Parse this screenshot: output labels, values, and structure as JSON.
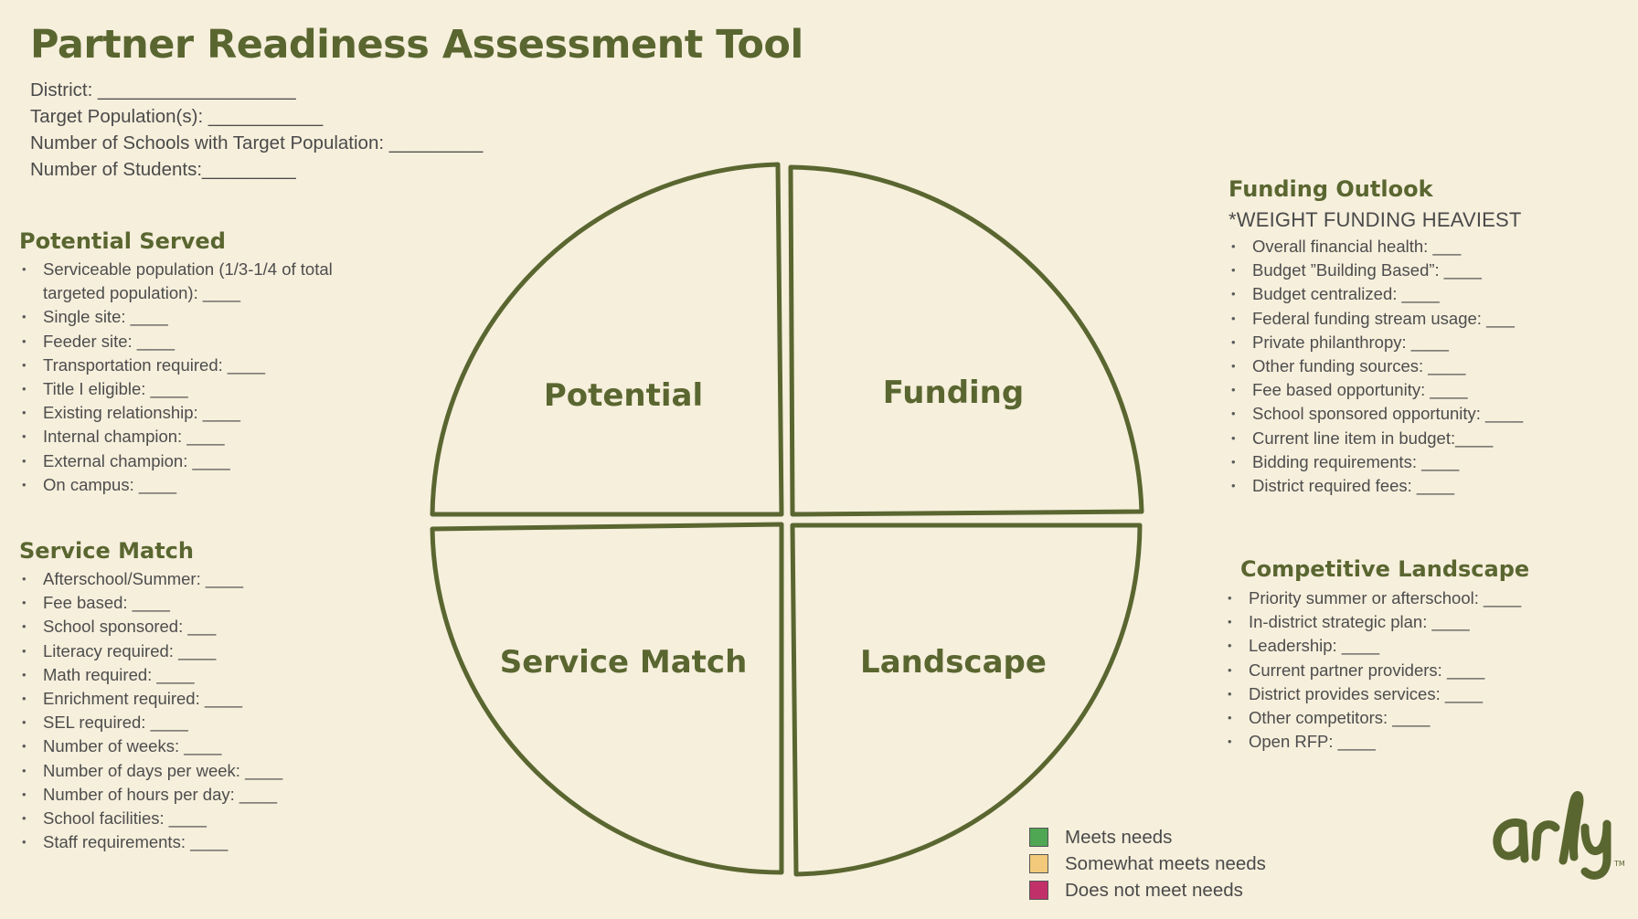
{
  "title": "Partner Readiness Assessment Tool",
  "header_fields": [
    "District:  ___________________",
    "Target Population(s): ___________",
    "Number of Schools with Target Population: _________",
    "Number of Students:_________"
  ],
  "potential_served": {
    "heading": "Potential Served",
    "items": [
      "Serviceable population (1/3-1/4 of total targeted population): ____",
      "Single site: ____",
      "Feeder site: ____",
      "Transportation required: ____",
      "Title I eligible: ____",
      "Existing relationship: ____",
      "Internal champion: ____",
      "External champion: ____",
      "On campus: ____"
    ]
  },
  "service_match": {
    "heading": "Service Match",
    "items": [
      "Afterschool/Summer: ____",
      "Fee based: ____",
      "School sponsored: ___",
      "Literacy required: ____",
      "Math required: ____",
      "Enrichment required: ____",
      "SEL required: ____",
      "Number of weeks: ____",
      "Number of days per week: ____",
      "Number of hours per day:  ____",
      "School facilities: ____",
      "Staff requirements: ____"
    ]
  },
  "funding_outlook": {
    "heading": "Funding Outlook",
    "subheading": "*WEIGHT FUNDING HEAVIEST",
    "items": [
      "Overall financial health: ___",
      "Budget ”Building Based”: ____",
      "Budget centralized: ____",
      "Federal funding stream usage: ___",
      "Private philanthropy: ____",
      "Other funding sources: ____",
      "Fee based opportunity:  ____",
      "School sponsored opportunity:  ____",
      "Current line item in budget:____",
      "Bidding requirements: ____",
      "District required fees: ____"
    ]
  },
  "competitive_landscape": {
    "heading": "Competitive Landscape",
    "items": [
      "Priority summer or afterschool: ____",
      "In-district strategic plan: ____",
      "Leadership: ____",
      "Current partner providers: ____",
      "District provides services: ____",
      "Other competitors: ____",
      "Open RFP: ____"
    ]
  },
  "quadrants": {
    "top_left": "Potential",
    "top_right": "Funding",
    "bottom_left": "Service Match",
    "bottom_right": "Landscape",
    "outline_color": "#5a6630"
  },
  "legend": [
    {
      "label": "Meets needs",
      "color": "#4fa653"
    },
    {
      "label": "Somewhat meets needs",
      "color": "#f2c97a"
    },
    {
      "label": "Does not meet needs",
      "color": "#c2306a"
    }
  ],
  "logo": {
    "text": "arly",
    "trademark": "TM",
    "color": "#5a6630"
  }
}
